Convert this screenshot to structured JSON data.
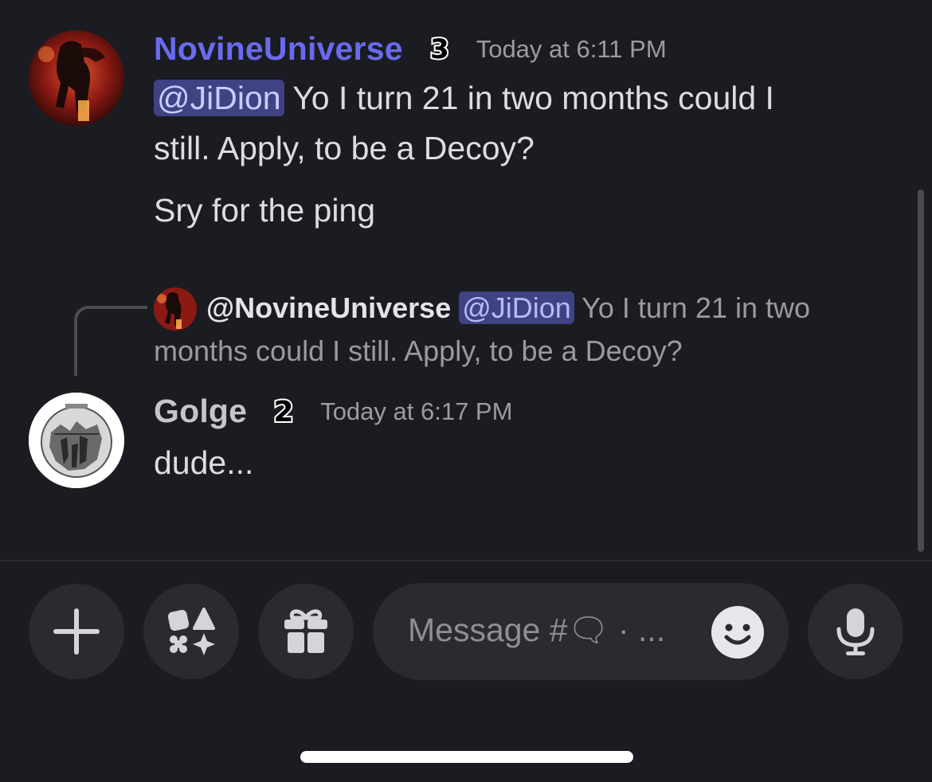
{
  "messages": [
    {
      "username": "NovineUniverse",
      "badge": "3",
      "timestamp": "Today at 6:11 PM",
      "mention": "@JiDion",
      "line1": " Yo I turn 21 in two months could I",
      "line2": "still. Apply, to be a Decoy?",
      "line3": "Sry for the ping",
      "username_color": "#6a6af0"
    },
    {
      "reply": {
        "author": "@NovineUniverse",
        "mention": "@JiDion",
        "text": " Yo I turn 21 in two months could I still. Apply, to be a Decoy?"
      },
      "username": "Golge",
      "badge": "2",
      "timestamp": "Today at 6:17 PM",
      "text": "dude..."
    }
  ],
  "composer": {
    "placeholder": "Message #🗨 · ...",
    "add_icon": "plus-icon",
    "apps_icon": "apps-icon",
    "gift_icon": "gift-icon",
    "emoji_icon": "smile-icon",
    "mic_icon": "microphone-icon"
  },
  "colors": {
    "background": "#1b1c21",
    "mention_bg": "#3f4383",
    "button_bg": "#2a2b31"
  }
}
